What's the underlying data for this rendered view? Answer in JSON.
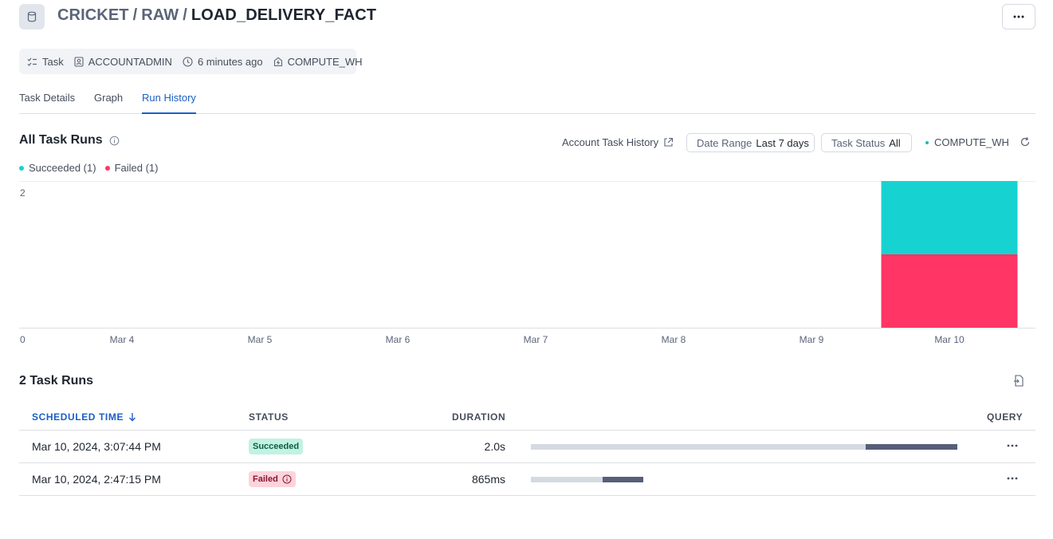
{
  "header": {
    "icon": "database-icon",
    "breadcrumb": [
      "CRICKET",
      "RAW"
    ],
    "separator": "/",
    "title": "LOAD_DELIVERY_FACT"
  },
  "meta": {
    "type": "Task",
    "owner": "ACCOUNTADMIN",
    "time": "6 minutes ago",
    "warehouse": "COMPUTE_WH"
  },
  "tabs": [
    {
      "label": "Task Details",
      "active": false
    },
    {
      "label": "Graph",
      "active": false
    },
    {
      "label": "Run History",
      "active": true
    }
  ],
  "section": {
    "title": "All Task Runs",
    "account_history": "Account Task History",
    "date_range_label": "Date Range",
    "date_range_value": "Last 7 days",
    "status_label": "Task Status",
    "status_value": "All",
    "warehouse": "COMPUTE_WH"
  },
  "legend": [
    {
      "label": "Succeeded (1)",
      "color": "#16d3d1"
    },
    {
      "label": "Failed (1)",
      "color": "#fe3565"
    }
  ],
  "chart_data": {
    "type": "bar",
    "stacked": true,
    "categories": [
      "Mar 4",
      "Mar 5",
      "Mar 6",
      "Mar 7",
      "Mar 8",
      "Mar 9",
      "Mar 10"
    ],
    "series": [
      {
        "name": "Failed",
        "values": [
          0,
          0,
          0,
          0,
          0,
          0,
          1
        ],
        "color": "#fe3565"
      },
      {
        "name": "Succeeded",
        "values": [
          0,
          0,
          0,
          0,
          0,
          0,
          1
        ],
        "color": "#16d3d1"
      }
    ],
    "yticks": [
      "0",
      "2"
    ],
    "ylim": [
      0,
      2
    ],
    "grid": true
  },
  "runs": {
    "title": "2 Task Runs",
    "columns": {
      "scheduled": "SCHEDULED TIME",
      "status": "STATUS",
      "duration": "DURATION",
      "query": "QUERY"
    },
    "rows": [
      {
        "time": "Mar 10, 2024, 3:07:44 PM",
        "status": "Succeeded",
        "duration": "2.0s",
        "queue_fraction": 0.785,
        "exec_fraction": 0.215
      },
      {
        "time": "Mar 10, 2024, 2:47:15 PM",
        "status": "Failed",
        "duration": "865ms",
        "queue_fraction": 0.168,
        "exec_fraction": 0.096
      }
    ]
  }
}
